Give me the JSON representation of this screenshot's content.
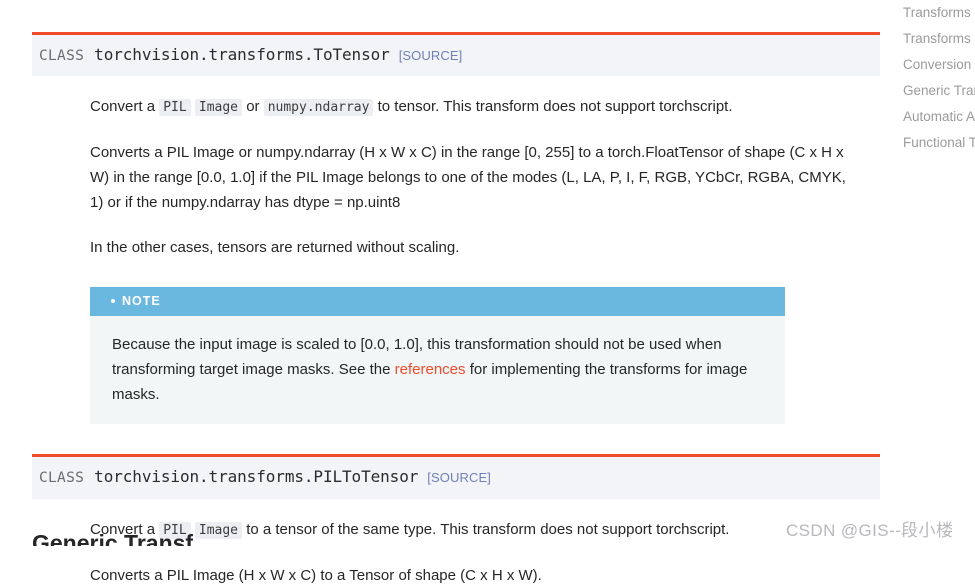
{
  "classes": [
    {
      "keyword": "CLASS",
      "signature": "torchvision.transforms.ToTensor",
      "source_label": "[SOURCE]",
      "paragraphs": {
        "p1_pre": "Convert a",
        "p1_code1": "PIL",
        "p1_code2": "Image",
        "p1_mid": "or",
        "p1_code3": "numpy.ndarray",
        "p1_post": "to tensor. This transform does not support torchscript.",
        "p2": "Converts a PIL Image or numpy.ndarray (H x W x C) in the range [0, 255] to a torch.FloatTensor of shape (C x H x W) in the range [0.0, 1.0] if the PIL Image belongs to one of the modes (L, LA, P, I, F, RGB, YCbCr, RGBA, CMYK, 1) or if the numpy.ndarray has dtype = np.uint8",
        "p3": "In the other cases, tensors are returned without scaling."
      },
      "note": {
        "title": "NOTE",
        "text_pre": "Because the input image is scaled to [0.0, 1.0], this transformation should not be used when transforming target image masks. See the",
        "link": "references",
        "text_post": "for implementing the transforms for image masks."
      }
    },
    {
      "keyword": "CLASS",
      "signature": "torchvision.transforms.PILToTensor",
      "source_label": "[SOURCE]",
      "paragraphs": {
        "p1_pre": "Convert a",
        "p1_code1": "PIL",
        "p1_code2": "Image",
        "p1_post": "to a tensor of the same type. This transform does not support torchscript.",
        "p2": "Converts a PIL Image (H x W x C) to a Tensor of shape (C x H x W)."
      }
    }
  ],
  "sidebar": {
    "items": [
      {
        "label": "Transforms o"
      },
      {
        "label": "Transforms o"
      },
      {
        "label": "Conversion T"
      },
      {
        "label": "Generic Tran"
      },
      {
        "label": "Automatic A"
      },
      {
        "label": "Functional Tr"
      }
    ]
  },
  "cut_heading": "Generic Transf",
  "watermark": "CSDN @GIS--段小楼",
  "colors": {
    "accent": "#ee4c2c",
    "note_header": "#6ab8e0",
    "source_link": "#6f7fbb",
    "sig_background": "#f3f4f7",
    "note_body_background": "#f3f6f6"
  }
}
